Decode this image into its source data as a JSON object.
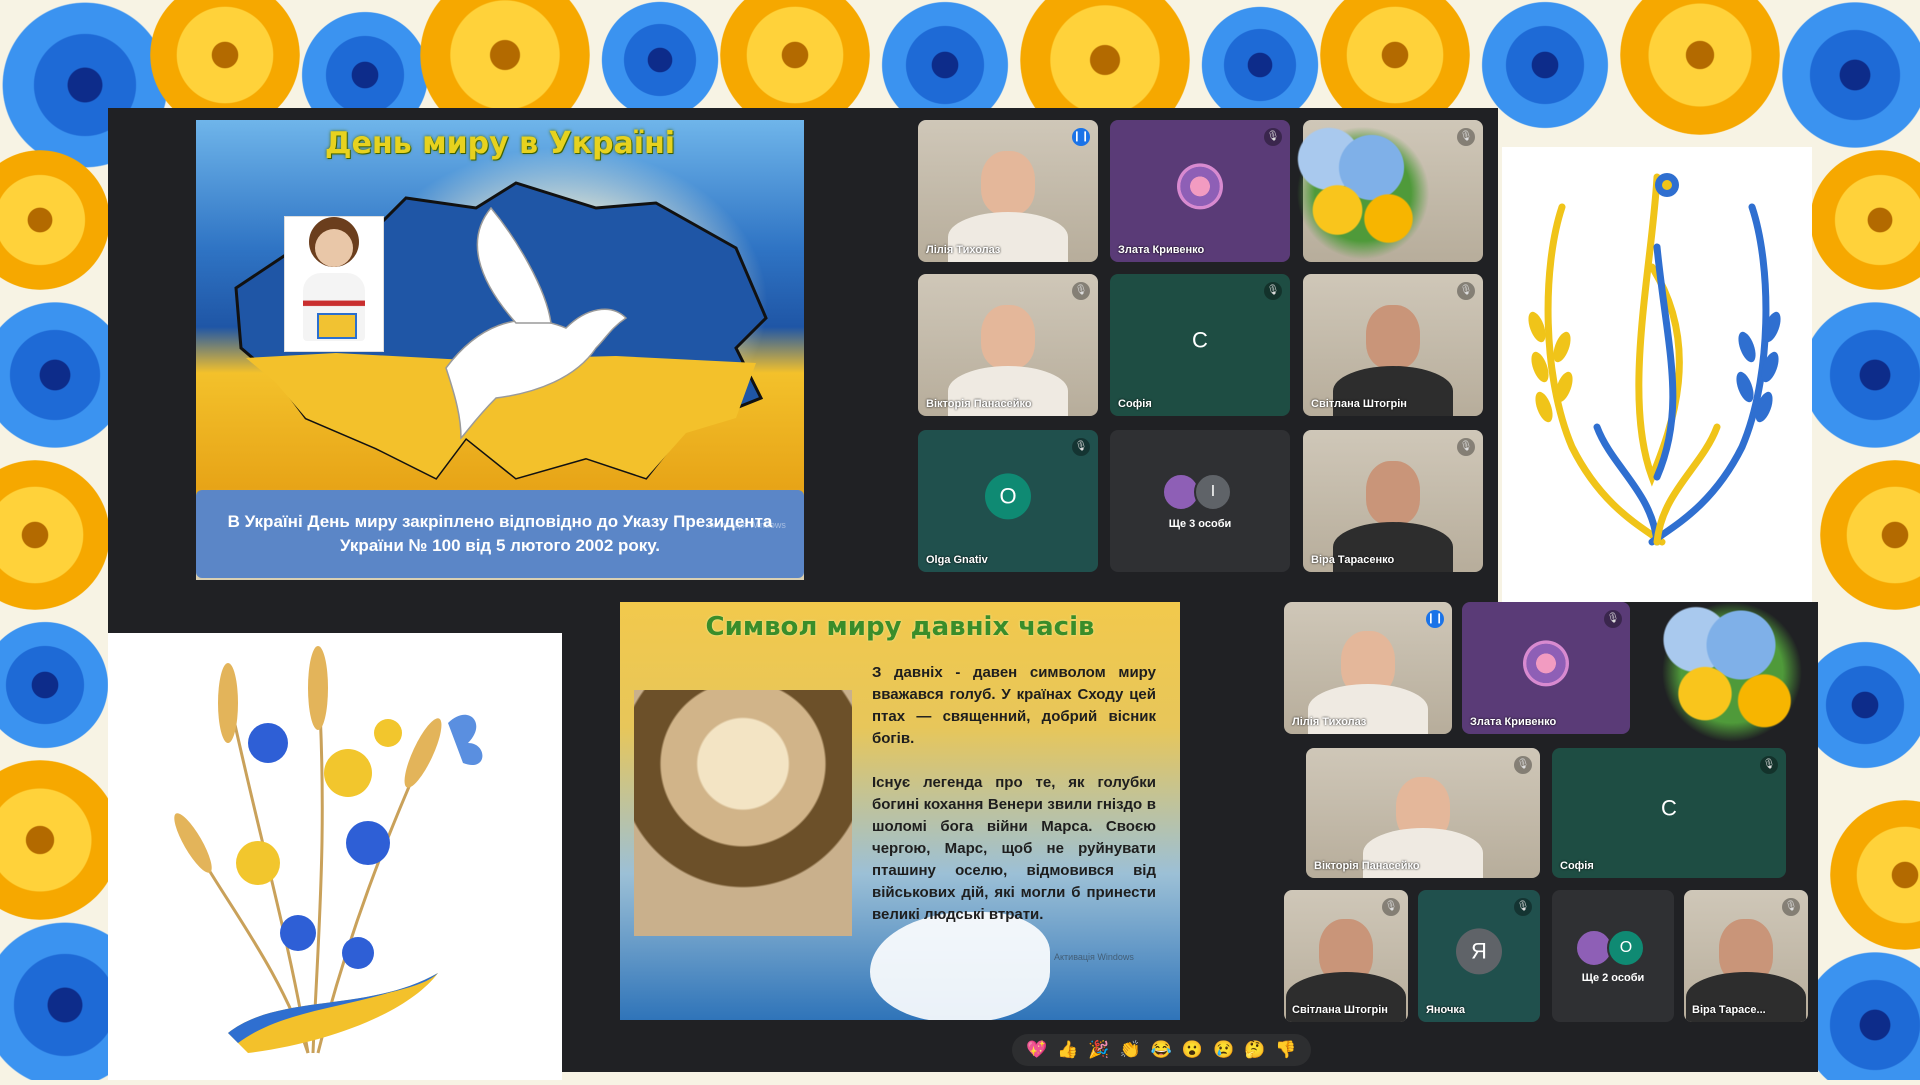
{
  "meeting_top": {
    "slide": {
      "title": "День миру в Україні",
      "caption": "В Україні День миру закріплено відповідно до Указу Президента України № 100 від 5 лютого 2002 року.",
      "watermark": "Активація Windows"
    },
    "participants": [
      {
        "name": "Лілія Тихолаз",
        "state": "speaking",
        "kind": "video"
      },
      {
        "name": "Злата Кривенко",
        "state": "muted",
        "kind": "avatar"
      },
      {
        "name": "",
        "state": "muted",
        "kind": "video"
      },
      {
        "name": "Вікторія Панасейко",
        "state": "muted",
        "kind": "video"
      },
      {
        "name": "Софія",
        "state": "muted",
        "kind": "letter",
        "letter": "С"
      },
      {
        "name": "Світлана Штогрін",
        "state": "muted",
        "kind": "video"
      },
      {
        "name": "Olga Gnativ",
        "state": "muted",
        "kind": "letter",
        "letter": "O"
      },
      {
        "name": "Ще 3 особи",
        "state": "",
        "kind": "group",
        "letter": "I"
      },
      {
        "name": "Віра Тарасенко",
        "state": "muted",
        "kind": "video"
      }
    ]
  },
  "meeting_bottom": {
    "slide": {
      "title": "Символ миру давніх часів",
      "para1": "З давніх - давен символом миру вважався голуб. У країнах Сходу цей птах — священний, добрий вісник богів.",
      "para2": "Існує легенда про те, як голубки богині кохання Венери звили гніздо в шоломі бога війни Марса. Своєю чергою, Марс, щоб не руйнувати пташину оселю, відмовився від військових дій, які могли б принести великі людські втрати.",
      "watermark": "Активація Windows"
    },
    "participants": [
      {
        "name": "Лілія Тихолаз",
        "state": "speaking",
        "kind": "video"
      },
      {
        "name": "Злата Кривенко",
        "state": "muted",
        "kind": "avatar"
      },
      {
        "name": "Вікторія Панасейко",
        "state": "muted",
        "kind": "video"
      },
      {
        "name": "Софія",
        "state": "muted",
        "kind": "letter",
        "letter": "С"
      },
      {
        "name": "Світлана Штогрін",
        "state": "muted",
        "kind": "video"
      },
      {
        "name": "Яночка",
        "state": "muted",
        "kind": "letter",
        "letter": "Я"
      },
      {
        "name": "Ще 2 особи",
        "state": "",
        "kind": "group",
        "letter": "O"
      },
      {
        "name": "Віра Тарасе...",
        "state": "muted",
        "kind": "video"
      }
    ],
    "reactions": [
      "💖",
      "👍",
      "🎉",
      "👏",
      "😂",
      "😮",
      "😢",
      "🤔",
      "👎"
    ]
  },
  "colors": {
    "ukraine_blue": "#1f56a6",
    "ukraine_yellow": "#f3c12b",
    "meet_bg": "#202124"
  }
}
